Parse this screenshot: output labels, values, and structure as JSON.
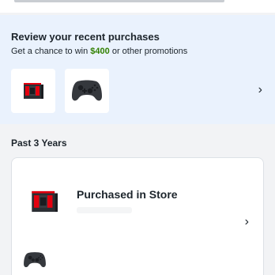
{
  "review": {
    "title": "Review your recent purchases",
    "subtitle_prefix": "Get a chance to win ",
    "subtitle_amount": "$400",
    "subtitle_suffix": " or other promotions",
    "thumbnails": [
      {
        "icon": "console-box-icon"
      },
      {
        "icon": "game-controller-icon"
      }
    ],
    "chevron": "›"
  },
  "history": {
    "title": "Past 3 Years",
    "order": {
      "label": "Purchased in Store",
      "chevron": "›",
      "items": [
        {
          "icon": "console-box-icon"
        },
        {
          "icon": "game-controller-icon"
        }
      ]
    }
  },
  "colors": {
    "accent_green": "#318000",
    "review_bg": "#eaf2fd",
    "page_bg": "#f2f3f5"
  }
}
